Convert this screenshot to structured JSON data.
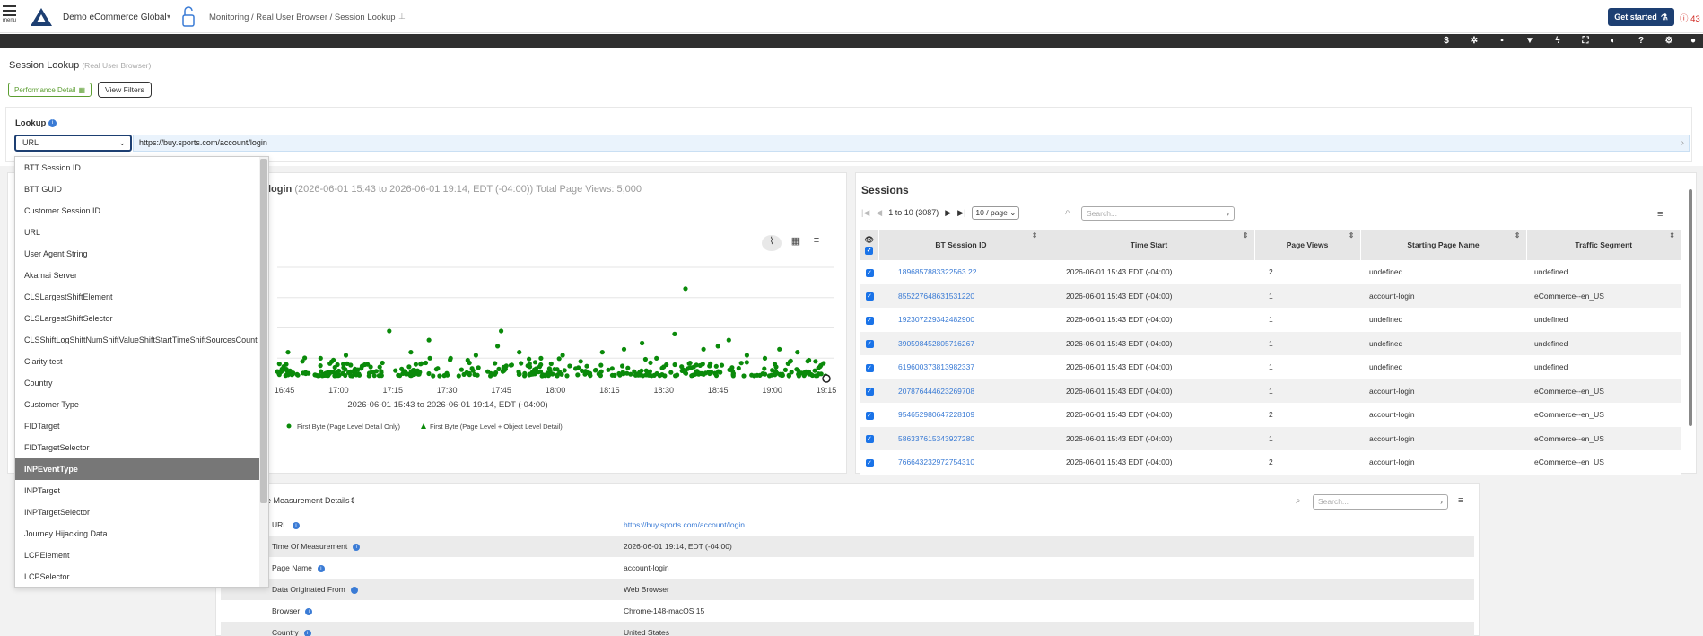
{
  "topbar": {
    "menu_label": "menu",
    "org_name": "Demo eCommerce Global",
    "breadcrumb": "Monitoring / Real User Browser / Session Lookup",
    "get_started": "Get started",
    "alert_count": "43"
  },
  "toolbar_icons": [
    "dollar-icon",
    "magic-icon",
    "comment-icon",
    "filter-icon",
    "bolt-icon",
    "expand-icon",
    "contrast-icon",
    "help-icon",
    "gear-icon",
    "user-icon"
  ],
  "page": {
    "title": "Session Lookup",
    "subtitle": "(Real User Browser)",
    "perf_button": "Performance Detail",
    "filters_button": "View Filters"
  },
  "lookup": {
    "label": "Lookup",
    "selected": "URL",
    "value": "https://buy.sports.com/account/login"
  },
  "dropdown": {
    "items": [
      "BTT Session ID",
      "BTT GUID",
      "Customer Session ID",
      "URL",
      "User Agent String",
      "Akamai Server",
      "CLSLargestShiftElement",
      "CLSLargestShiftSelector",
      "CLSShiftLogShiftNumShiftValueShiftStartTimeShiftSourcesCount",
      "Clarity test",
      "Country",
      "Customer Type",
      "FIDTarget",
      "FIDTargetSelector",
      "INPEventType",
      "INPTarget",
      "INPTargetSelector",
      "Journey Hijacking Data",
      "LCPElement",
      "LCPSelector"
    ],
    "active": "INPEventType"
  },
  "chart": {
    "title": "login",
    "range": "(2026-06-01 15:43 to 2026-06-01 19:14, EDT (-04:00))",
    "total": "Total Page Views: 5,000",
    "color": "#0a8a0a"
  },
  "chart_data": {
    "type": "scatter",
    "title": "login (2026-06-01 15:43 to 2026-06-01 19:14, EDT (-04:00)) Total Page Views: 5,000",
    "xlabel": "2026-06-01 15:43 to 2026-06-01 19:14, EDT (-04:00)",
    "ylabel": "",
    "x_ticks": [
      "16:45",
      "17:00",
      "17:15",
      "17:30",
      "17:45",
      "18:00",
      "18:15",
      "18:30",
      "18:45",
      "19:00",
      "19:15"
    ],
    "legend": [
      "First Byte (Page Level Detail Only)",
      "First Byte (Page Level + Object Level Detail)"
    ],
    "legend_position": "bottom",
    "grid": true,
    "series": [
      {
        "name": "First Byte (Page Level Detail Only)",
        "marker": "circle",
        "points_hhmm": [
          [
            "16:46",
            0.9
          ],
          [
            "16:50",
            0.6
          ],
          [
            "16:55",
            0.7
          ],
          [
            "17:02",
            0.8
          ],
          [
            "17:08",
            0.5
          ],
          [
            "17:14",
            1.6
          ],
          [
            "17:20",
            0.9
          ],
          [
            "17:25",
            1.3
          ],
          [
            "17:31",
            0.7
          ],
          [
            "17:38",
            0.8
          ],
          [
            "17:44",
            1.1
          ],
          [
            "17:45",
            1.6
          ],
          [
            "17:50",
            0.9
          ],
          [
            "17:56",
            0.7
          ],
          [
            "18:02",
            0.8
          ],
          [
            "18:07",
            0.6
          ],
          [
            "18:13",
            0.9
          ],
          [
            "18:19",
            1.0
          ],
          [
            "18:24",
            1.2
          ],
          [
            "18:28",
            0.7
          ],
          [
            "18:33",
            1.5
          ],
          [
            "18:36",
            3.0
          ],
          [
            "18:41",
            1.0
          ],
          [
            "18:45",
            1.1
          ],
          [
            "18:48",
            1.3
          ],
          [
            "18:53",
            0.8
          ],
          [
            "18:58",
            0.7
          ],
          [
            "19:02",
            1.0
          ],
          [
            "19:07",
            0.9
          ],
          [
            "19:12",
            0.6
          ]
        ]
      },
      {
        "name": "First Byte (Page Level + Object Level Detail)",
        "marker": "triangle",
        "points_hhmm": []
      }
    ]
  },
  "sessions": {
    "title": "Sessions",
    "range_text": "1 to 10 (3087)",
    "page_size": "10 / page",
    "search_placeholder": "Search...",
    "columns": [
      "BT Session ID",
      "Time Start",
      "Page Views",
      "Starting Page Name",
      "Traffic Segment"
    ],
    "rows": [
      {
        "id": "1896857883322563 22",
        "time": "2026-06-01 15:43 EDT (-04:00)",
        "pv": "2",
        "page": "undefined",
        "segment": "undefined"
      },
      {
        "id": "855227648631531220",
        "time": "2026-06-01 15:43 EDT (-04:00)",
        "pv": "1",
        "page": "account-login",
        "segment": "eCommerce--en_US"
      },
      {
        "id": "192307229342482900",
        "time": "2026-06-01 15:43 EDT (-04:00)",
        "pv": "1",
        "page": "undefined",
        "segment": "undefined"
      },
      {
        "id": "390598452805716267",
        "time": "2026-06-01 15:43 EDT (-04:00)",
        "pv": "1",
        "page": "undefined",
        "segment": "undefined"
      },
      {
        "id": "619600373813982337",
        "time": "2026-06-01 15:43 EDT (-04:00)",
        "pv": "1",
        "page": "undefined",
        "segment": "undefined"
      },
      {
        "id": "207876444623269708",
        "time": "2026-06-01 15:43 EDT (-04:00)",
        "pv": "1",
        "page": "account-login",
        "segment": "eCommerce--en_US"
      },
      {
        "id": "954652980647228109",
        "time": "2026-06-01 15:43 EDT (-04:00)",
        "pv": "2",
        "page": "account-login",
        "segment": "eCommerce--en_US"
      },
      {
        "id": "586337615343927280",
        "time": "2026-06-01 15:43 EDT (-04:00)",
        "pv": "1",
        "page": "account-login",
        "segment": "eCommerce--en_US"
      },
      {
        "id": "766643232972754310",
        "time": "2026-06-01 15:43 EDT (-04:00)",
        "pv": "2",
        "page": "account-login",
        "segment": "eCommerce--en_US"
      }
    ]
  },
  "details": {
    "title": "e Measurement Details",
    "search_placeholder": "Search...",
    "rows": [
      {
        "key": "URL",
        "value": "https://buy.sports.com/account/login",
        "link": true
      },
      {
        "key": "Time Of Measurement",
        "value": "2026-06-01 19:14, EDT (-04:00)"
      },
      {
        "key": "Page Name",
        "value": "account-login"
      },
      {
        "key": "Data Originated From",
        "value": "Web Browser"
      },
      {
        "key": "Browser",
        "value": "Chrome-148-macOS 15"
      },
      {
        "key": "Country",
        "value": "United States"
      }
    ]
  }
}
